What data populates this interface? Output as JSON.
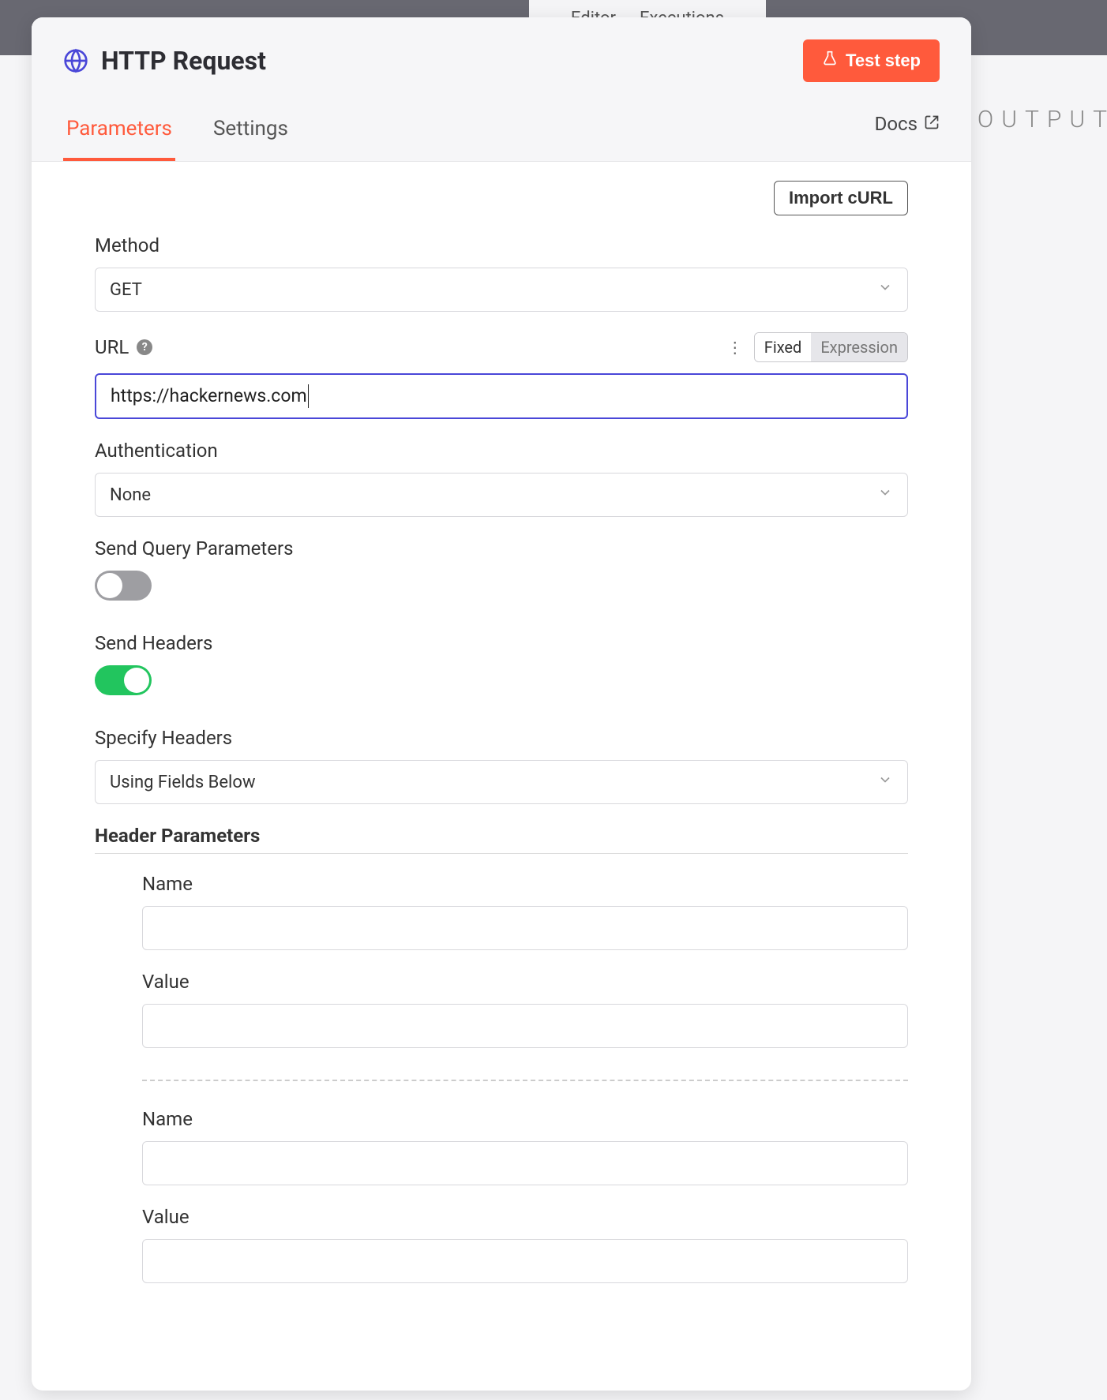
{
  "topbar": {
    "pill_left": "Editor",
    "pill_right": "Executions"
  },
  "output_label": "OUTPUT",
  "header": {
    "title": "HTTP Request",
    "test_button": "Test step",
    "tabs": {
      "parameters": "Parameters",
      "settings": "Settings",
      "docs": "Docs"
    }
  },
  "actions": {
    "import_curl": "Import cURL"
  },
  "method": {
    "label": "Method",
    "value": "GET"
  },
  "url": {
    "label": "URL",
    "value": "https://hackernews.com",
    "segmented": {
      "fixed": "Fixed",
      "expression": "Expression"
    }
  },
  "auth": {
    "label": "Authentication",
    "value": "None"
  },
  "query_params": {
    "label": "Send Query Parameters",
    "enabled": false
  },
  "send_headers": {
    "label": "Send Headers",
    "enabled": true
  },
  "specify_headers": {
    "label": "Specify Headers",
    "value": "Using Fields Below"
  },
  "header_params": {
    "heading": "Header Parameters",
    "name_label": "Name",
    "value_label": "Value",
    "items": [
      {
        "name": "",
        "value": ""
      },
      {
        "name": "",
        "value": ""
      }
    ]
  }
}
